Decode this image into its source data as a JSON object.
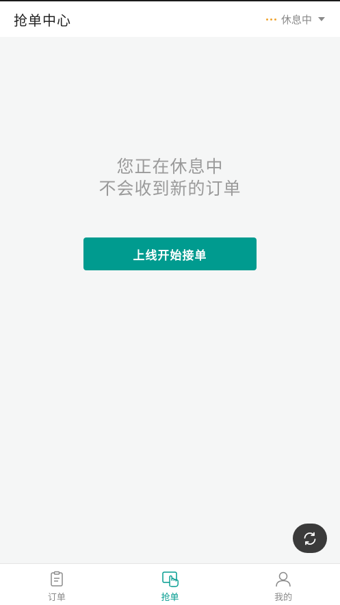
{
  "header": {
    "title": "抢单中心",
    "status_label": "休息中"
  },
  "main": {
    "rest_line1": "您正在休息中",
    "rest_line2": "不会收到新的订单",
    "online_button_label": "上线开始接单"
  },
  "fab": {
    "icon": "refresh-icon"
  },
  "tabs": [
    {
      "label": "订单",
      "icon": "order-clipboard-icon",
      "active": false
    },
    {
      "label": "抢单",
      "icon": "grab-order-hand-icon",
      "active": true
    },
    {
      "label": "我的",
      "icon": "profile-icon",
      "active": false
    }
  ],
  "colors": {
    "accent": "#009b8f",
    "status_dots": "#f0a431",
    "background": "#f5f6f6"
  }
}
